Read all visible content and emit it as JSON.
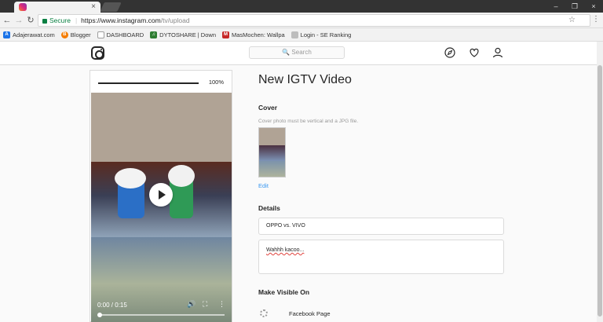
{
  "browser": {
    "tab_close": "×",
    "secure_label": "Secure",
    "url_host": "https://www.instagram.com",
    "url_path": "/tv/upload",
    "window_controls": [
      "–",
      "❐",
      "×"
    ]
  },
  "bookmarks": [
    {
      "label": "Adajerawat.com",
      "icon": "A",
      "color": "#1a73e8"
    },
    {
      "label": "Blogger",
      "icon": "B",
      "color": "#f57d00"
    },
    {
      "label": "DASHBOARD",
      "icon": "",
      "color": "#9e9e9e"
    },
    {
      "label": "DYTOSHARE | Down",
      "icon": "♫",
      "color": "#2e7d32"
    },
    {
      "label": "MasMochen: Wallpa",
      "icon": "M",
      "color": "#c62828"
    },
    {
      "label": "Login - SE Ranking",
      "icon": "",
      "color": "#bdbdbd"
    }
  ],
  "header": {
    "search_placeholder": "🔍 Search",
    "icons": [
      "compass-icon",
      "heart-icon",
      "user-icon"
    ]
  },
  "upload": {
    "progress_label": "100%",
    "progress": 1.0,
    "video_time": "0:00 / 0:15"
  },
  "main": {
    "page_title": "New IGTV Video",
    "cover_label": "Cover",
    "cover_hint": "Cover photo must be vertical and a JPG file.",
    "edit_label": "Edit",
    "details_label": "Details",
    "title_value": "OPPO vs. VIVO",
    "description_value": "Wahhh kacoo...",
    "visible_label": "Make Visible On",
    "facebook_label": "Facebook Page"
  }
}
